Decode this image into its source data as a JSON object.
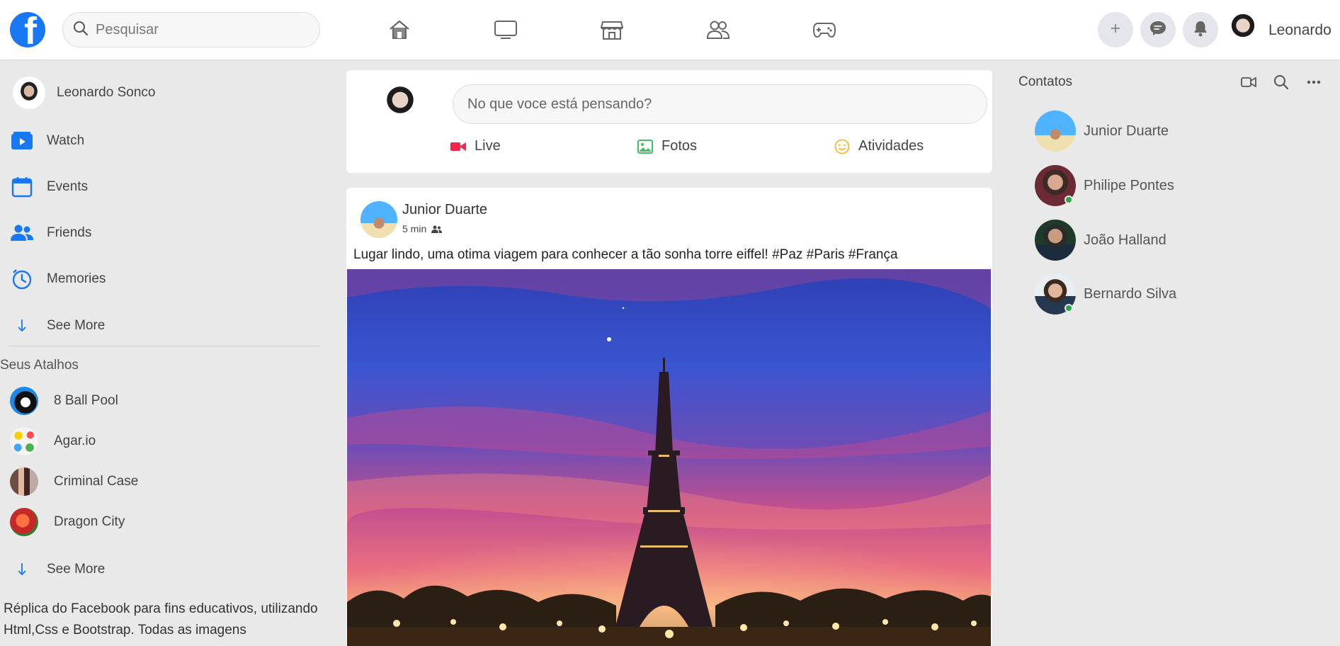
{
  "topbar": {
    "search_placeholder": "Pesquisar",
    "username": "Leonardo",
    "nav_icons": [
      "home-icon",
      "tv-icon",
      "marketplace-icon",
      "groups-icon",
      "gaming-icon"
    ],
    "action_icons": [
      "plus-icon",
      "messenger-icon",
      "bell-icon"
    ]
  },
  "sidebar": {
    "profile_name": "Leonardo Sonco",
    "items": [
      {
        "label": "Watch",
        "icon": "watch-icon"
      },
      {
        "label": "Events",
        "icon": "calendar-icon"
      },
      {
        "label": "Friends",
        "icon": "friends-icon"
      },
      {
        "label": "Memories",
        "icon": "clock-icon"
      },
      {
        "label": "See More",
        "icon": "arrow-down-icon"
      }
    ],
    "shortcuts_title": "Seus Atalhos",
    "shortcuts": [
      {
        "label": "8 Ball Pool"
      },
      {
        "label": "Agar.io"
      },
      {
        "label": "Criminal Case"
      },
      {
        "label": "Dragon City"
      }
    ],
    "shortcuts_see_more": "See More",
    "footer_text": "Réplica do Facebook para fins educativos, utilizando Html,Css e Bootstrap. Todas as imagens"
  },
  "composer": {
    "placeholder": "No que voce está pensando?",
    "actions": [
      {
        "label": "Live",
        "icon": "live-video-icon",
        "color": "#f02849"
      },
      {
        "label": "Fotos",
        "icon": "photo-icon",
        "color": "#45bd62"
      },
      {
        "label": "Atividades",
        "icon": "smiley-icon",
        "color": "#f7b928"
      }
    ]
  },
  "post": {
    "author": "Junior Duarte",
    "time": "5 min",
    "text": "Lugar lindo, uma otima viagem para conhecer a tão sonha torre eiffel! #Paz #Paris #França"
  },
  "contacts": {
    "title": "Contatos",
    "header_icons": [
      "video-call-icon",
      "search-icon",
      "more-icon"
    ],
    "list": [
      {
        "name": "Junior Duarte",
        "online": false
      },
      {
        "name": "Philipe Pontes",
        "online": true
      },
      {
        "name": "João Halland",
        "online": false
      },
      {
        "name": "Bernardo Silva",
        "online": true
      }
    ]
  },
  "colors": {
    "brand": "#1877f2",
    "background": "#e9e9e9",
    "online": "#31a24c"
  }
}
